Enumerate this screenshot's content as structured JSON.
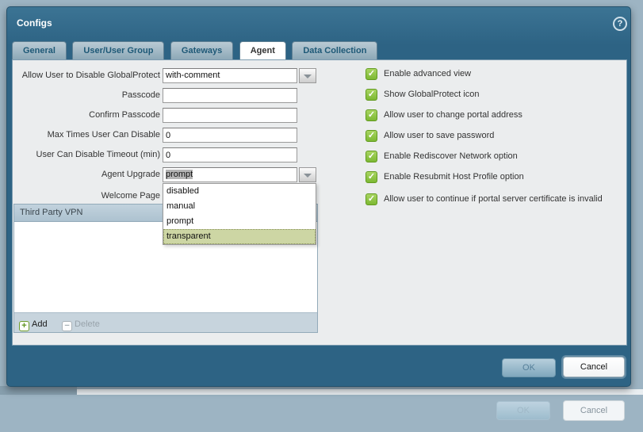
{
  "dialog": {
    "title": "Configs",
    "tabs": [
      {
        "label": "General",
        "state": "validation-error"
      },
      {
        "label": "User/User Group"
      },
      {
        "label": "Gateways"
      },
      {
        "label": "Agent",
        "active": true
      },
      {
        "label": "Data Collection"
      }
    ],
    "form": {
      "fields": [
        {
          "label": "Allow User to Disable GlobalProtect",
          "value": "with-comment",
          "type": "dropdown"
        },
        {
          "label": "Passcode",
          "value": "",
          "type": "text"
        },
        {
          "label": "Confirm Passcode",
          "value": "",
          "type": "text"
        },
        {
          "label": "Max Times User Can Disable",
          "value": "0",
          "type": "text"
        },
        {
          "label": "User Can Disable Timeout (min)",
          "value": "0",
          "type": "text"
        },
        {
          "label": "Agent Upgrade",
          "value": "prompt",
          "type": "dropdown",
          "open": true,
          "value_selected": true
        },
        {
          "label": "Welcome Page",
          "value": "",
          "type": "dropdown"
        }
      ],
      "agent_upgrade_options": [
        "disabled",
        "manual",
        "prompt",
        "transparent"
      ],
      "hovered_option": "transparent"
    },
    "table": {
      "header": "Third Party VPN",
      "rows": [],
      "add_label": "Add",
      "delete_label": "Delete",
      "delete_enabled": false
    },
    "checkboxes": [
      {
        "label": "Enable advanced view",
        "checked": true
      },
      {
        "label": "Show GlobalProtect icon",
        "checked": true
      },
      {
        "label": "Allow user to change portal address",
        "checked": true
      },
      {
        "label": "Allow user to save password",
        "checked": true
      },
      {
        "label": "Enable Rediscover Network option",
        "checked": true
      },
      {
        "label": "Enable Resubmit Host Profile option",
        "checked": true
      },
      {
        "label": "Allow user to continue if portal server certificate is invalid",
        "checked": true
      }
    ],
    "footer": {
      "ok_label": "OK",
      "cancel_label": "Cancel"
    }
  },
  "background_dialog": {
    "ok_label": "OK",
    "cancel_label": "Cancel"
  },
  "icons": {
    "help": "?",
    "checkbox_check": "✓",
    "add": "+",
    "delete": "−"
  },
  "colors": {
    "dialog_chrome": "#2d6384",
    "panel": "#ebedee",
    "checkbox_green": "#7cb832",
    "option_highlight": "#cdd6a4",
    "validation_error": "#b22222",
    "mask": "#9db4c3"
  }
}
